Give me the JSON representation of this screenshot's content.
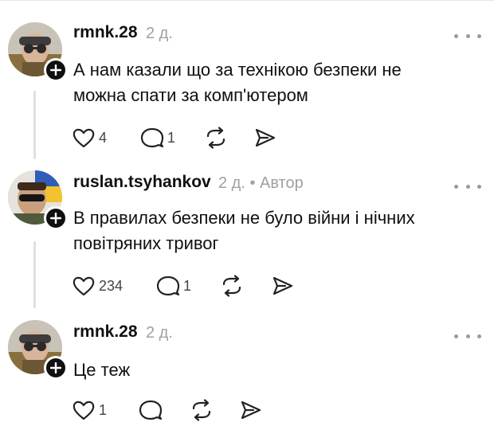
{
  "posts": [
    {
      "username": "rmnk.28",
      "time": "2 д.",
      "badge": "",
      "text_line1": "А нам казали що за технікою безпеки не",
      "text_line2": "можна спати за комп'ютером",
      "likes": "4",
      "replies": "1",
      "avatar_accent": "#8a6f3e"
    },
    {
      "username": "ruslan.tsyhankov",
      "time": "2 д.",
      "badge": "• Автор",
      "text_line1": "В правилах безпеки не було війни і нічних",
      "text_line2": "повітряних тривог",
      "likes": "234",
      "replies": "1",
      "avatar_accent": "#2f5db8"
    },
    {
      "username": "rmnk.28",
      "time": "2 д.",
      "badge": "",
      "text_line1": "Це теж",
      "text_line2": "",
      "likes": "1",
      "replies": "",
      "avatar_accent": "#8a6f3e"
    }
  ],
  "icons": {
    "like": "heart-icon",
    "reply": "comment-bubble-icon",
    "repost": "repost-icon",
    "share": "send-icon",
    "more": "more-dots-icon",
    "follow": "plus-icon"
  },
  "colors": {
    "text": "#101010",
    "muted": "#a0a0a0",
    "thread_line": "#e0e0e0"
  }
}
